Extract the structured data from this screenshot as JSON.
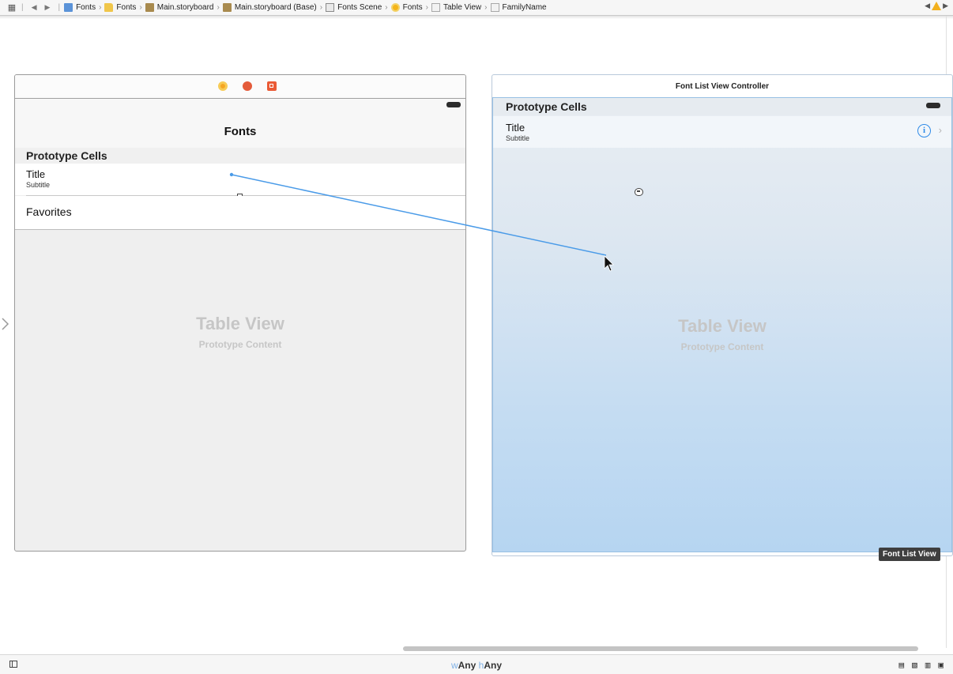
{
  "jumpbar": {
    "crumbs": [
      "Fonts",
      "Fonts",
      "Main.storyboard",
      "Main.storyboard (Base)",
      "Fonts Scene",
      "Fonts",
      "Table View",
      "FamilyName"
    ]
  },
  "left_scene": {
    "nav_title": "Fonts",
    "section_header": "Prototype Cells",
    "cell_title": "Title",
    "cell_subtitle": "Subtitle",
    "favorites_label": "Favorites",
    "placeholder_title": "Table View",
    "placeholder_subtitle": "Prototype Content"
  },
  "right_scene": {
    "title": "Font List View Controller",
    "section_header": "Prototype Cells",
    "cell_title": "Title",
    "cell_subtitle": "Subtitle",
    "info_glyph": "i",
    "placeholder_title": "Table View",
    "placeholder_subtitle": "Prototype Content",
    "drop_label": "Font List View"
  },
  "bottombar": {
    "w_prefix": "w",
    "w_value": "Any",
    "h_prefix": "h",
    "h_value": "Any"
  },
  "colors": {
    "connection_line": "#4a9be8",
    "selection_blue": "#b6d5f1",
    "warning": "#f2b01e"
  }
}
